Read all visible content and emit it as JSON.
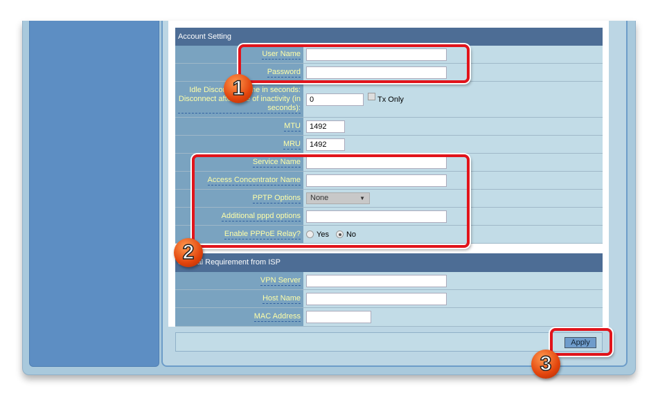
{
  "account": {
    "title": "Account Setting",
    "user_name": "User Name",
    "password": "Password",
    "idle_label": "Idle Disconnect Time in seconds: Disconnect after time of inactivity (in seconds):",
    "idle_value": "0",
    "tx_only": "Tx Only",
    "mtu": "MTU",
    "mtu_value": "1492",
    "mru": "MRU",
    "mru_value": "1492",
    "service_name": "Service Name",
    "ac_name": "Access Concentrator Name",
    "pptp": "PPTP Options",
    "pptp_value": "None",
    "pppd": "Additional pppd options",
    "relay": "Enable PPPoE Relay?",
    "yes": "Yes",
    "no": "No",
    "relay_selected": "No"
  },
  "isp": {
    "title": "Special Requirement from ISP",
    "vpn": "VPN Server",
    "host": "Host Name",
    "mac": "MAC Address"
  },
  "apply": "Apply",
  "badges": [
    "1",
    "2",
    "3"
  ],
  "colors": {
    "header": "#4d6d95",
    "highlight": "#e1141b",
    "label_text": "#ffffa8"
  }
}
